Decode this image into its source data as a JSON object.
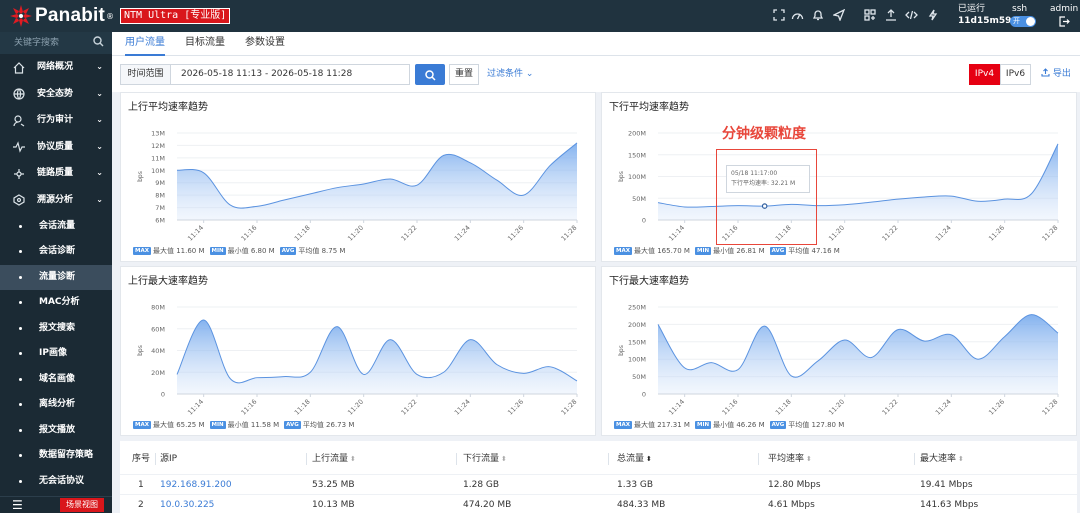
{
  "topbar": {
    "logo_text": "Panabit",
    "logo_mark": "®",
    "product_badge": "NTM Ultra [专业版]",
    "icons": [
      "fullscreen-icon",
      "dashboard-icon",
      "bell-icon",
      "send-icon",
      "layout-icon",
      "upload-icon",
      "code-icon",
      "bolt-icon"
    ],
    "uptime_label": "已运行",
    "uptime_value": "11d15m59s",
    "ssh_label": "ssh",
    "ssh_toggle": "开",
    "admin_label": "admin",
    "logout_icon": "logout-icon"
  },
  "sidebar": {
    "search_placeholder": "关键字搜索",
    "parent_items": [
      {
        "label": "网络概况",
        "icon": "home-icon"
      },
      {
        "label": "安全态势",
        "icon": "globe-icon"
      },
      {
        "label": "行为审计",
        "icon": "user-search-icon"
      },
      {
        "label": "协议质量",
        "icon": "pulse-icon"
      },
      {
        "label": "链路质量",
        "icon": "link-icon"
      },
      {
        "label": "溯源分析",
        "icon": "trace-icon"
      }
    ],
    "child_items": [
      {
        "label": "会话流量"
      },
      {
        "label": "会话诊断"
      },
      {
        "label": "流量诊断",
        "active": true
      },
      {
        "label": "MAC分析"
      },
      {
        "label": "报文搜索"
      },
      {
        "label": "IP画像"
      },
      {
        "label": "域名画像"
      },
      {
        "label": "离线分析"
      },
      {
        "label": "报文播放"
      },
      {
        "label": "数据留存策略"
      },
      {
        "label": "无会话协议"
      }
    ],
    "scene_button": "场景视图"
  },
  "tabs": [
    {
      "label": "用户流量",
      "active": true
    },
    {
      "label": "目标流量"
    },
    {
      "label": "参数设置"
    }
  ],
  "filter": {
    "time_label": "时间范围",
    "time_value": "2026-05-18 11:13 - 2026-05-18 11:28",
    "reset_label": "重置",
    "filter_cond_label": "过滤条件",
    "ipv4_label": "IPv4",
    "ipv6_label": "IPv6",
    "ip_selected": "IPv4",
    "export_label": "导出"
  },
  "annotation": {
    "text": "分钟级颗粒度",
    "color": "#e8463a"
  },
  "tooltip": {
    "time": "05/18 11:17:00",
    "label": "下行平均速率: 32.21 M"
  },
  "legend_badges": {
    "max": "MAX",
    "min": "MIN",
    "avg": "AVG"
  },
  "chart_data": [
    {
      "id": "up-avg",
      "type": "area",
      "title": "上行平均速率趋势",
      "ylabel": "bps",
      "yticks": [
        "6M",
        "7M",
        "8M",
        "9M",
        "10M",
        "11M",
        "12M",
        "13M"
      ],
      "ylim": [
        6,
        13
      ],
      "xticks": [
        "11:14",
        "11:16",
        "11:18",
        "11:20",
        "11:22",
        "11:24",
        "11:26",
        "11:28"
      ],
      "x": [
        13,
        14,
        15,
        16,
        17,
        18,
        19,
        20,
        21,
        22,
        23,
        24,
        25,
        26,
        27,
        28
      ],
      "values": [
        10.0,
        9.8,
        7.2,
        7.1,
        7.6,
        8.1,
        8.6,
        8.9,
        9.3,
        8.8,
        11.2,
        10.6,
        9.2,
        8.0,
        10.4,
        12.2
      ],
      "legend": {
        "max": "最大值 11.60 M",
        "min": "最小值 6.80 M",
        "avg": "平均值 8.75 M"
      }
    },
    {
      "id": "down-avg",
      "type": "area",
      "title": "下行平均速率趋势",
      "ylabel": "bps",
      "yticks": [
        "0",
        "50M",
        "100M",
        "150M",
        "200M"
      ],
      "ylim": [
        0,
        200
      ],
      "xticks": [
        "11:14",
        "11:16",
        "11:18",
        "11:20",
        "11:22",
        "11:24",
        "11:26",
        "11:28"
      ],
      "x": [
        13,
        14,
        15,
        16,
        17,
        18,
        19,
        20,
        21,
        22,
        23,
        24,
        25,
        26,
        27,
        28
      ],
      "values": [
        40,
        30,
        31,
        33,
        32,
        36,
        33,
        35,
        41,
        48,
        53,
        55,
        43,
        48,
        60,
        175
      ],
      "legend": {
        "max": "最大值 165.70 M",
        "min": "最小值 26.81 M",
        "avg": "平均值 47.16 M"
      }
    },
    {
      "id": "up-max",
      "type": "area",
      "title": "上行最大速率趋势",
      "ylabel": "bps",
      "yticks": [
        "0",
        "20M",
        "40M",
        "60M",
        "80M"
      ],
      "ylim": [
        0,
        80
      ],
      "xticks": [
        "11:14",
        "11:16",
        "11:18",
        "11:20",
        "11:22",
        "11:24",
        "11:26",
        "11:28"
      ],
      "x": [
        13,
        14,
        15,
        16,
        17,
        18,
        19,
        20,
        21,
        22,
        23,
        24,
        25,
        26,
        27,
        28
      ],
      "values": [
        18,
        68,
        14,
        15,
        16,
        20,
        62,
        18,
        50,
        18,
        20,
        50,
        27,
        19,
        25,
        12
      ],
      "legend": {
        "max": "最大值 65.25 M",
        "min": "最小值 11.58 M",
        "avg": "平均值 26.73 M"
      }
    },
    {
      "id": "down-max",
      "type": "area",
      "title": "下行最大速率趋势",
      "ylabel": "bps",
      "yticks": [
        "0",
        "50M",
        "100M",
        "150M",
        "200M",
        "250M"
      ],
      "ylim": [
        0,
        250
      ],
      "xticks": [
        "11:14",
        "11:16",
        "11:18",
        "11:20",
        "11:22",
        "11:24",
        "11:26",
        "11:28"
      ],
      "x": [
        13,
        14,
        15,
        16,
        17,
        18,
        19,
        20,
        21,
        22,
        23,
        24,
        25,
        26,
        27,
        28
      ],
      "values": [
        200,
        75,
        90,
        70,
        195,
        52,
        95,
        155,
        105,
        185,
        152,
        170,
        100,
        165,
        228,
        175
      ],
      "legend": {
        "max": "最大值 217.31 M",
        "min": "最小值 46.26 M",
        "avg": "平均值 127.80 M"
      }
    }
  ],
  "table": {
    "headers": [
      "序号",
      "源IP",
      "上行流量",
      "下行流量",
      "总流量",
      "平均速率",
      "最大速率"
    ],
    "rows": [
      [
        "1",
        "192.168.91.200",
        "53.25 MB",
        "1.28 GB",
        "1.33 GB",
        "12.80 Mbps",
        "19.41 Mbps"
      ],
      [
        "2",
        "10.0.30.225",
        "10.13 MB",
        "474.20 MB",
        "484.33 MB",
        "4.61 Mbps",
        "141.63 Mbps"
      ]
    ]
  }
}
